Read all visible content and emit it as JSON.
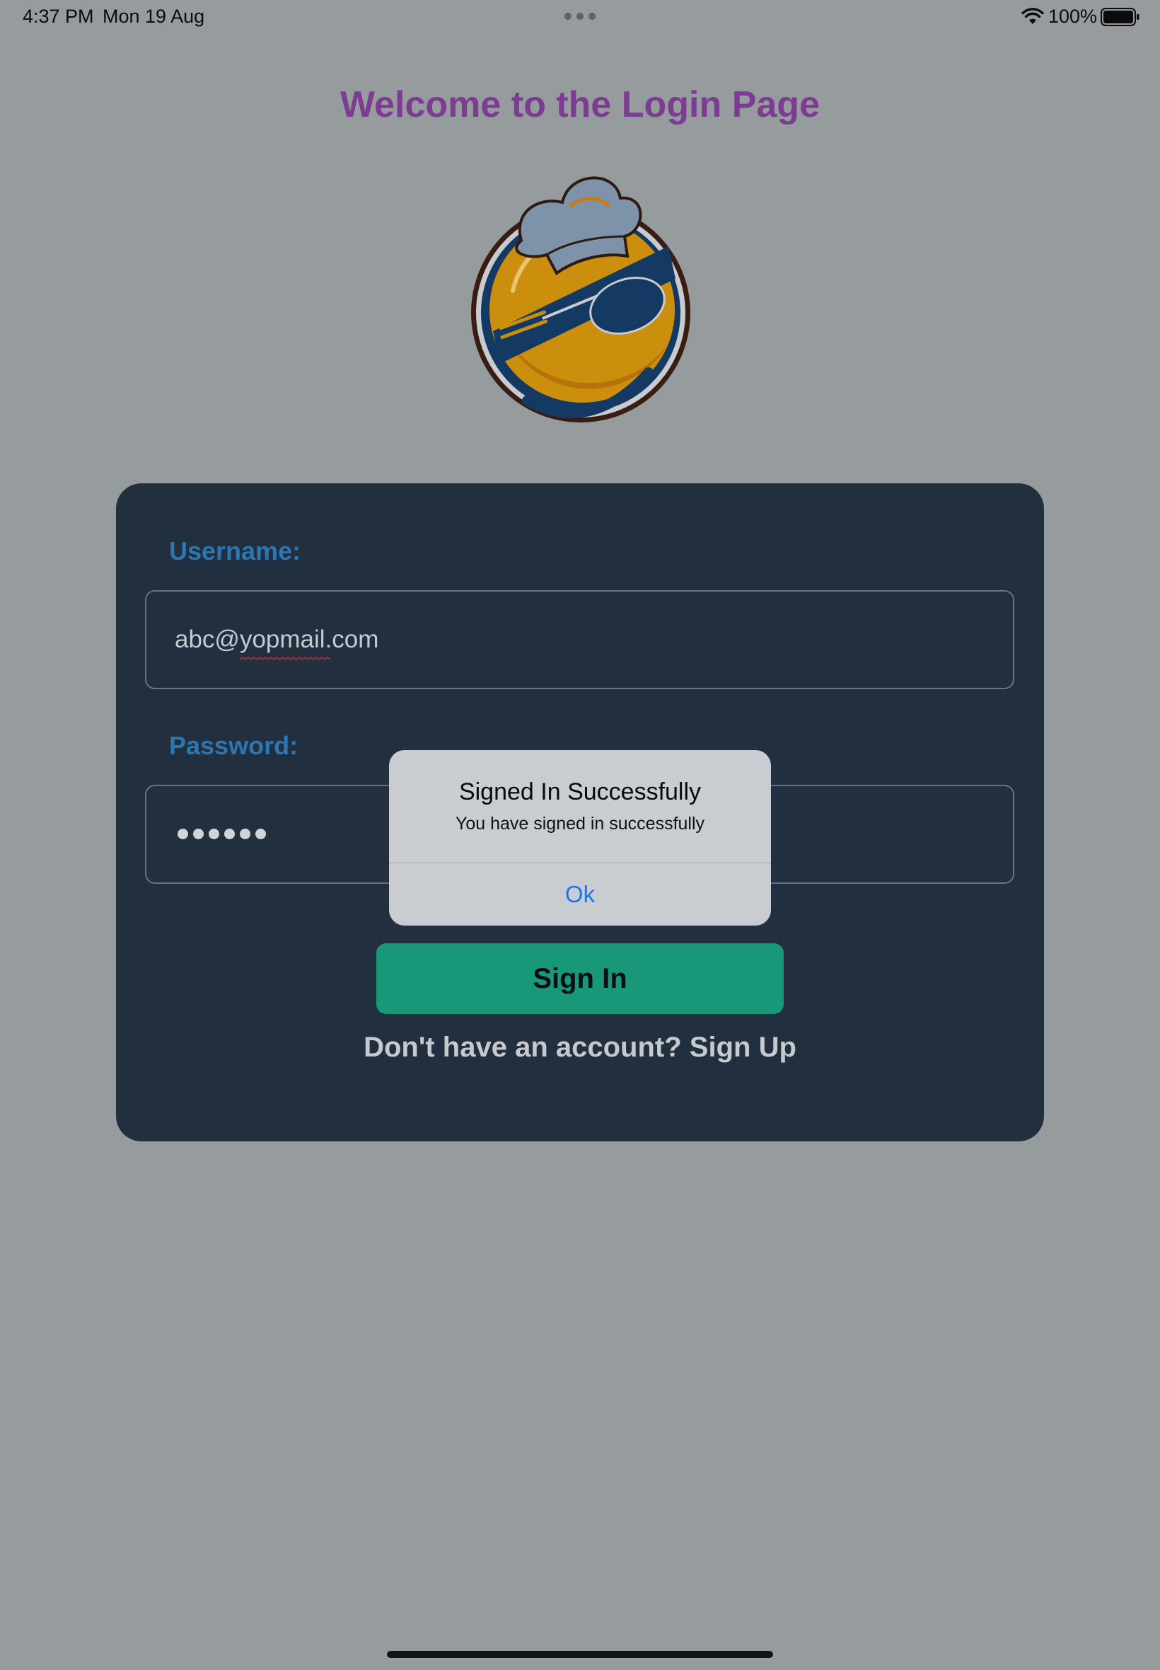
{
  "status_bar": {
    "time": "4:37 PM",
    "date": "Mon 19 Aug",
    "battery_percent": "100%",
    "icons": [
      "wifi-icon",
      "battery-icon",
      "multitasking-dots-icon"
    ]
  },
  "page": {
    "title": "Welcome to the Login Page",
    "logo_icon": "chef-smiley-logo-icon"
  },
  "form": {
    "username_label": "Username:",
    "username_value": "abc@yopmail.com",
    "password_label": "Password:",
    "password_dot_count": 6,
    "sign_in_label": "Sign In",
    "signup_text": "Don't have an account? Sign Up"
  },
  "alert": {
    "title": "Signed In Successfully",
    "message": "You have signed in successfully",
    "ok_label": "Ok"
  },
  "colors": {
    "dimmed_background": "#969b9e",
    "card": "#222f3e",
    "title": "#7b3c91",
    "label": "#2c76b1",
    "button": "#189879",
    "alert_background": "#c9cdd2",
    "alert_action": "#1e74e8"
  }
}
